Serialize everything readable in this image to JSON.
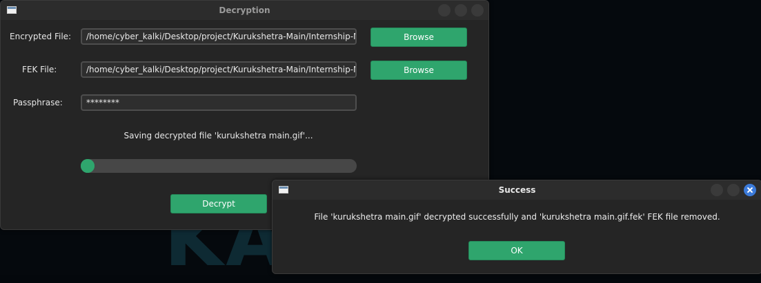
{
  "decryption_window": {
    "title": "Decryption",
    "encrypted_file": {
      "label": "Encrypted File:",
      "value": "/home/cyber_kalki/Desktop/project/Kurukshetra-Main/Internship-M",
      "browse_label": "Browse"
    },
    "fek_file": {
      "label": "FEK File:",
      "value": "/home/cyber_kalki/Desktop/project/Kurukshetra-Main/Internship-M",
      "browse_label": "Browse"
    },
    "passphrase": {
      "label": "Passphrase:",
      "value": "********"
    },
    "status": "Saving decrypted file 'kurukshetra main.gif'...",
    "progress_fraction": 0.0,
    "decrypt_label": "Decrypt"
  },
  "success_dialog": {
    "title": "Success",
    "message": "File 'kurukshetra main.gif' decrypted successfully and 'kurukshetra main.gif.fek' FEK file removed.",
    "ok_label": "OK"
  },
  "desktop": {
    "wallpaper_text": "KALI"
  },
  "colors": {
    "accent_green": "#2fa56d",
    "close_button_blue": "#3b7ad9",
    "window_bg": "#252525"
  }
}
